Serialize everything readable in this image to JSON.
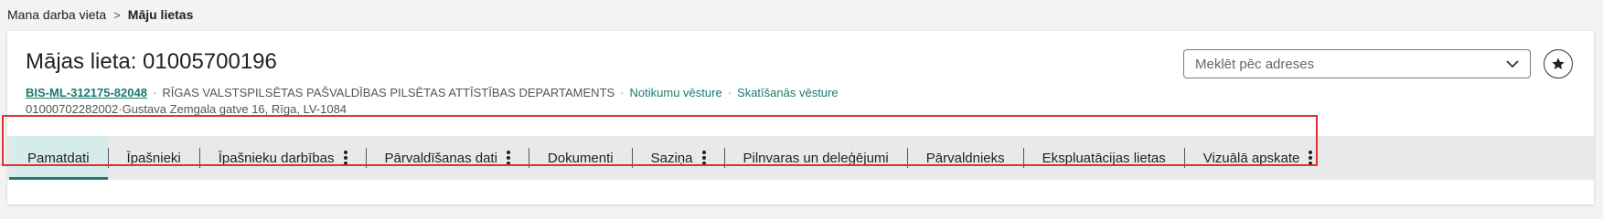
{
  "breadcrumb": {
    "home": "Mana darba vieta",
    "separator": ">",
    "current": "Māju lietas"
  },
  "header": {
    "title": "Mājas lieta: 01005700196",
    "bis_code": "BIS-ML-312175-82048",
    "department": "RĪGAS VALSTSPILSĒTAS PAŠVALDĪBAS PILSĒTAS ATTĪSTĪBAS DEPARTAMENTS",
    "link_events": "Notikumu vēsture",
    "link_views": "Skatīšanās vēsture",
    "cadastre": "01000702282002",
    "address": "Gustava Zemgala gatve 16, Rīga, LV-1084",
    "dot": "·"
  },
  "search": {
    "placeholder": "Meklēt pēc adreses"
  },
  "tabs": [
    {
      "label": "Pamatdati",
      "active": true,
      "menu": false
    },
    {
      "label": "Īpašnieki",
      "active": false,
      "menu": false
    },
    {
      "label": "Īpašnieku darbības",
      "active": false,
      "menu": true
    },
    {
      "label": "Pārvaldīšanas dati",
      "active": false,
      "menu": true
    },
    {
      "label": "Dokumenti",
      "active": false,
      "menu": false
    },
    {
      "label": "Saziņa",
      "active": false,
      "menu": true
    },
    {
      "label": "Pilnvaras un deleģējumi",
      "active": false,
      "menu": false
    },
    {
      "label": "Pārvaldnieks",
      "active": false,
      "menu": false
    },
    {
      "label": "Ekspluatācijas lietas",
      "active": false,
      "menu": false
    },
    {
      "label": "Vizuālā apskate",
      "active": false,
      "menu": true
    }
  ],
  "colors": {
    "accent": "#1a7a6e",
    "active_tab_bg": "#d5ecea",
    "highlight_border": "#e0302f"
  }
}
